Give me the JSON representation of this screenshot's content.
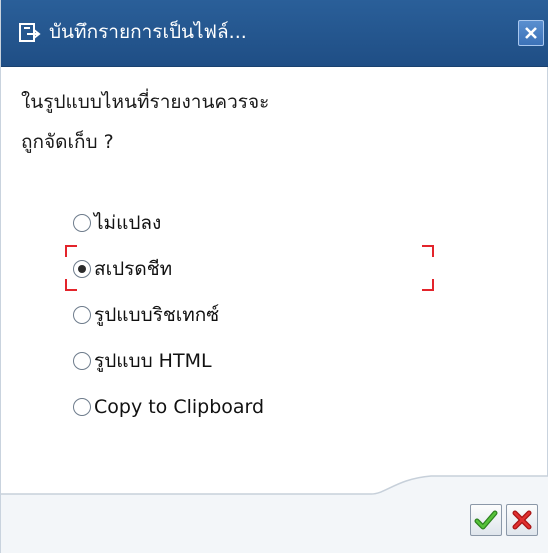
{
  "dialog": {
    "title": "บันทึกรายการเป็นไฟล์...",
    "title_icon": "export-dialog-icon",
    "close_icon": "close-icon"
  },
  "question": {
    "line1": "ในรูปแบบไหนที่รายงานควรจะ",
    "line2": "ถูกจัดเก็บ ?"
  },
  "options": [
    {
      "label": "ไม่แปลง",
      "checked": false
    },
    {
      "label": "สเปรดชีท",
      "checked": true
    },
    {
      "label": "รูปแบบริชเทกซ์",
      "checked": false
    },
    {
      "label": "รูปแบบ HTML",
      "checked": false
    },
    {
      "label": "Copy to Clipboard",
      "checked": false
    }
  ],
  "buttons": {
    "ok_icon": "checkmark-icon",
    "cancel_icon": "cancel-x-icon"
  },
  "colors": {
    "titlebar": "#2a5f99",
    "ok_check": "#3fa52a",
    "cancel_x": "#d42020",
    "focus": "#e3242b"
  }
}
